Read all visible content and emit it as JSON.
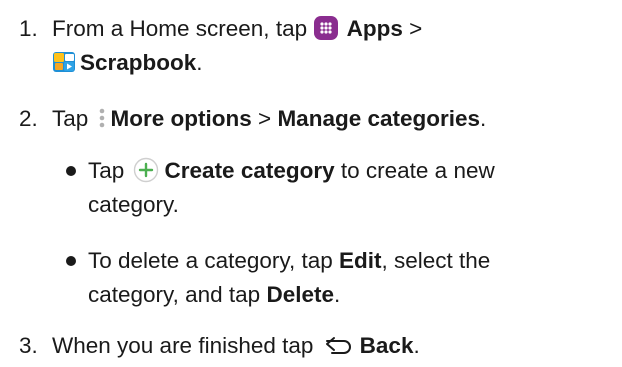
{
  "steps": [
    {
      "number": "1.",
      "line1_pre": "From a Home screen, tap ",
      "apps_label": "Apps",
      "line1_sep": " >",
      "scrapbook_label": "Scrapbook",
      "line2_end": "."
    },
    {
      "number": "2.",
      "pre": "Tap ",
      "more_label": "More options",
      "sep": " > ",
      "manage_label": "Manage categories",
      "end": "."
    },
    {
      "number": "3.",
      "pre": "When you are finished tap ",
      "back_label": "Back",
      "end": "."
    }
  ],
  "bullets": [
    {
      "pre": "Tap ",
      "create_label": "Create category",
      "line1_post": " to create a new",
      "line2": "category."
    },
    {
      "line1_pre": "To delete a category, tap ",
      "edit_label": "Edit",
      "line1_post": ", select the",
      "line2_pre": "category, and tap ",
      "delete_label": "Delete",
      "line2_end": "."
    }
  ],
  "icons": {
    "apps": "apps-grid-icon",
    "scrapbook": "scrapbook-app-icon",
    "more": "more-options-icon",
    "create": "plus-circle-icon",
    "back": "back-arrow-icon"
  },
  "colors": {
    "text": "#1a1a1a",
    "apps_icon_bg": "#8a2d8f",
    "plus_icon": "#4caf50",
    "more_icon": "#b0b0b0"
  }
}
